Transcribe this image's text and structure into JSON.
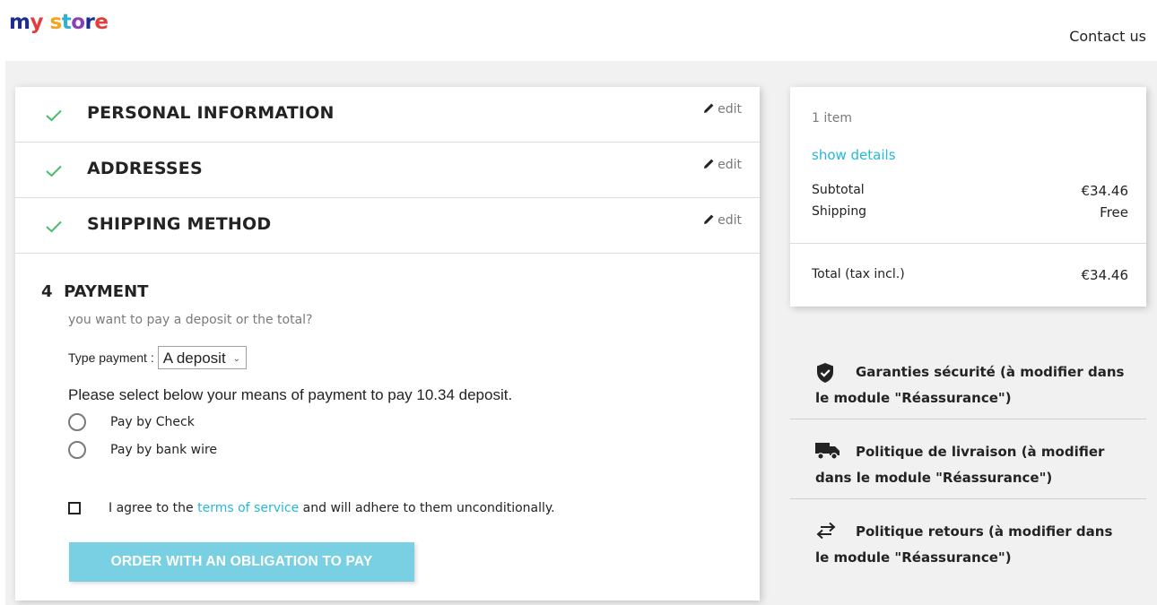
{
  "header": {
    "logo_text": "my store",
    "logo_colors": [
      "#1d2c8f",
      "#e23c3c",
      "#f7a21b",
      "#2cb1d2",
      "#8b3fb9"
    ],
    "contact_label": "Contact us"
  },
  "checkout": {
    "steps": [
      {
        "title": "PERSONAL INFORMATION",
        "edit_label": "edit",
        "complete": true
      },
      {
        "title": "ADDRESSES",
        "edit_label": "edit",
        "complete": true
      },
      {
        "title": "SHIPPING METHOD",
        "edit_label": "edit",
        "complete": true
      }
    ],
    "payment": {
      "number": "4",
      "title": "PAYMENT",
      "question": "you want to pay a deposit or the total?",
      "type_label": "Type payment :",
      "type_value": "A deposit",
      "means_text": "Please select below your means of payment to pay 10.34 deposit.",
      "options": [
        {
          "label": "Pay by Check",
          "selected": false
        },
        {
          "label": "Pay by bank wire",
          "selected": false
        }
      ],
      "terms_prefix": "I agree to the",
      "terms_link": "terms of service",
      "terms_suffix": "and will adhere to them unconditionally.",
      "order_button": "ORDER WITH AN OBLIGATION TO PAY"
    }
  },
  "summary": {
    "item_count": "1 item",
    "show_details": "show details",
    "subtotal_label": "Subtotal",
    "subtotal_value": "€34.46",
    "shipping_label": "Shipping",
    "shipping_value": "Free",
    "total_label": "Total (tax incl.)",
    "total_value": "€34.46"
  },
  "reassurance": [
    {
      "icon": "shield-check-icon",
      "text": "Garanties sécurité (à modifier dans le module \"Réassurance\")"
    },
    {
      "icon": "truck-icon",
      "text": "Politique de livraison (à modifier dans le module \"Réassurance\")"
    },
    {
      "icon": "exchange-arrows-icon",
      "text": "Politique retours (à modifier dans le module \"Réassurance\")"
    }
  ],
  "colors": {
    "accent": "#24b9d7",
    "check": "#4cbb6c",
    "button": "#7ad0e3",
    "page_bg": "#f1f1f1"
  }
}
